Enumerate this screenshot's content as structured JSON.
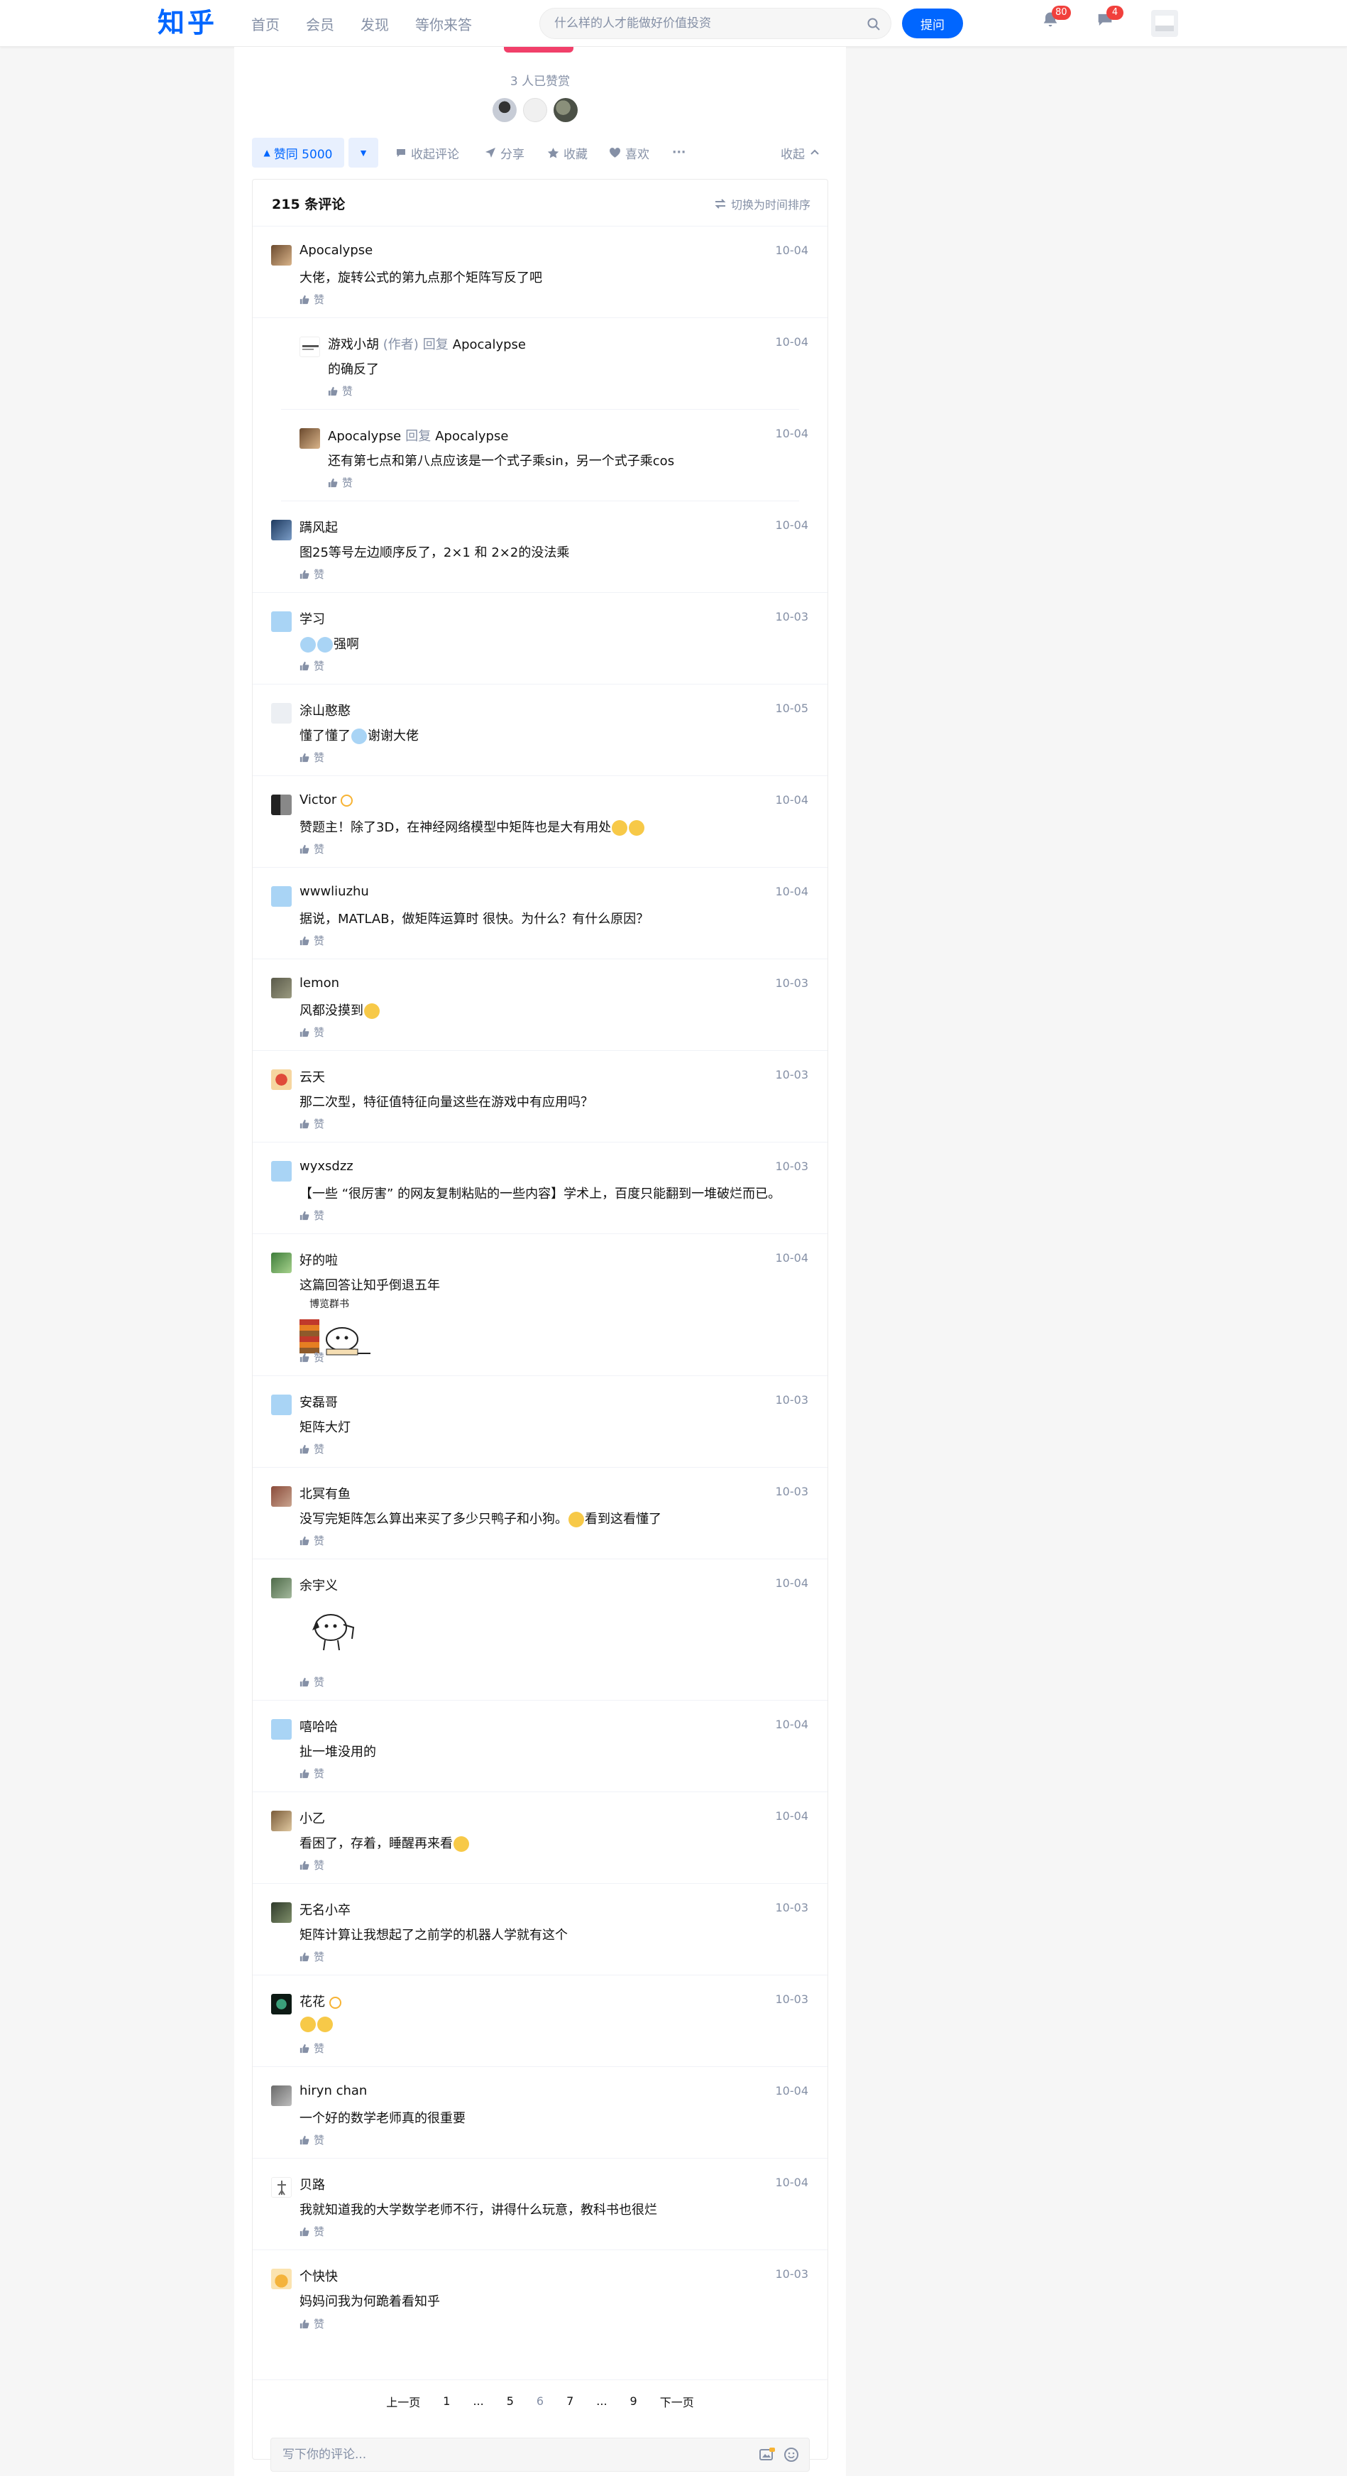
{
  "header": {
    "logo": "知乎",
    "nav": [
      "首页",
      "会员",
      "发现",
      "等你来答"
    ],
    "search_placeholder": "什么样的人才能做好价值投资",
    "ask_label": "提问",
    "notif_count": "80",
    "msg_count": "4"
  },
  "answer": {
    "reward_text": "3 人已赞赏",
    "vote_label": "赞同 5000",
    "actions": {
      "collapse_comments": "收起评论",
      "share": "分享",
      "favorite": "收藏",
      "like": "喜欢",
      "more": "···",
      "collapse": "收起"
    }
  },
  "comments": {
    "count_label": "215 条评论",
    "sort_label": "切换为时间排序",
    "like_label": "赞",
    "reply_word": "回复",
    "author_tag": "(作者)",
    "input_placeholder": "写下你的评论...",
    "items": [
      {
        "name": "Apocalypse",
        "date": "10-04",
        "text": "大佬，旋转公式的第九点那个矩阵写反了吧"
      },
      {
        "name": "游戏小胡",
        "author": true,
        "reply_to": "Apocalypse",
        "date": "10-04",
        "text": "的确反了"
      },
      {
        "name": "Apocalypse",
        "reply_to": "Apocalypse",
        "date": "10-04",
        "text": "还有第七点和第八点应该是一个式子乘sin，另一个式子乘cos"
      },
      {
        "name": "蹒风起",
        "date": "10-04",
        "text": "图25等号左边顺序反了，2×1 和 2×2的没法乘"
      },
      {
        "name": "学习",
        "date": "10-03",
        "text": "强啊"
      },
      {
        "name": "涂山憨憨",
        "date": "10-05",
        "text": "懂了懂了",
        "text2": "谢谢大佬"
      },
      {
        "name": "Victor",
        "date": "10-04",
        "text": "赞题主！除了3D，在神经网络模型中矩阵也是大有用处"
      },
      {
        "name": "wwwliuzhu",
        "date": "10-04",
        "text": "据说，MATLAB，做矩阵运算时 很快。为什么？有什么原因？"
      },
      {
        "name": "lemon",
        "date": "10-03",
        "text": "风都没摸到"
      },
      {
        "name": "云天",
        "date": "10-03",
        "text": "那二次型，特征值特征向量这些在游戏中有应用吗？"
      },
      {
        "name": "wyxsdzz",
        "date": "10-03",
        "text": "【一些 “很厉害” 的网友复制粘贴的一些内容】学术上，百度只能翻到一堆破烂而已。"
      },
      {
        "name": "好的啦",
        "date": "10-04",
        "text": "这篇回答让知乎倒退五年",
        "sticker_text": "博览群书"
      },
      {
        "name": "安磊哥",
        "date": "10-03",
        "text": "矩阵大灯"
      },
      {
        "name": "北冥有鱼",
        "date": "10-03",
        "text": "没写完矩阵怎么算出来买了多少只鸭子和小狗。",
        "text2": "看到这看懂了"
      },
      {
        "name": "余宇义",
        "date": "10-04",
        "text": ""
      },
      {
        "name": "嘻哈哈",
        "date": "10-04",
        "text": "扯一堆没用的"
      },
      {
        "name": "小乙",
        "date": "10-04",
        "text": "看困了，存着，睡醒再来看"
      },
      {
        "name": "无名小卒",
        "date": "10-03",
        "text": "矩阵计算让我想起了之前学的机器人学就有这个"
      },
      {
        "name": "花花",
        "date": "10-03",
        "text": ""
      },
      {
        "name": "hiryn chan",
        "date": "10-04",
        "text": "一个好的数学老师真的很重要"
      },
      {
        "name": "贝路",
        "date": "10-04",
        "text": "我就知道我的大学数学老师不行，讲得什么玩意，教科书也很烂"
      },
      {
        "name": "个快快",
        "date": "10-03",
        "text": "妈妈问我为何跪着看知乎"
      }
    ]
  },
  "pagination": {
    "prev": "上一页",
    "p1": "1",
    "e1": "...",
    "p5": "5",
    "p6": "6",
    "p7": "7",
    "e2": "...",
    "p9": "9",
    "next": "下一页"
  }
}
